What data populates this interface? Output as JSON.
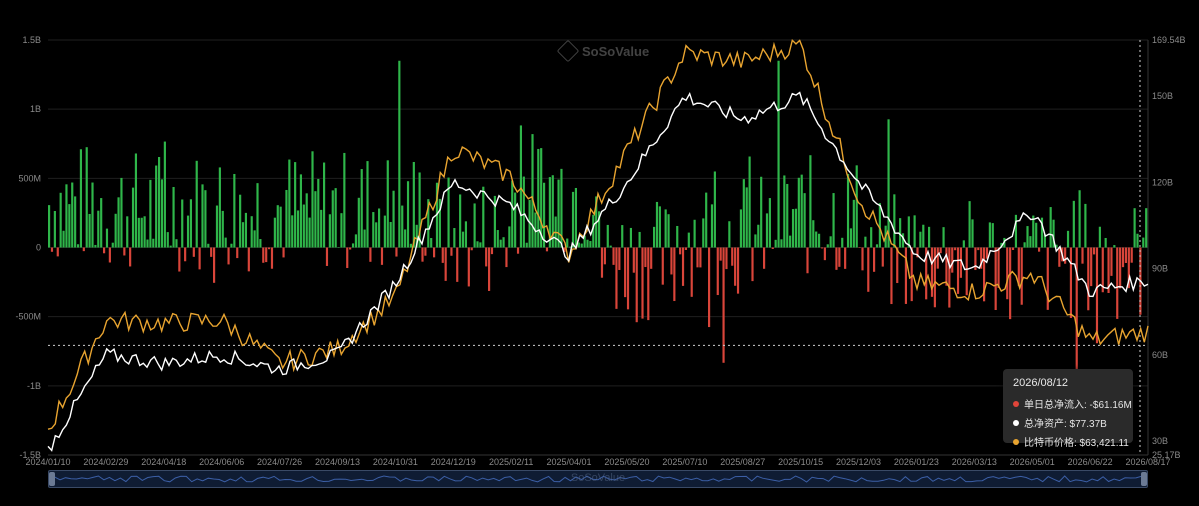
{
  "watermark": {
    "brand": "SoSoValue"
  },
  "chart_data": {
    "type": "bar",
    "left_axis_ticks": [
      "1.5B",
      "1B",
      "500M",
      "0",
      "-500M",
      "-1B",
      "-1.5B"
    ],
    "left_axis_values": [
      1.5,
      1,
      0.5,
      0,
      -0.5,
      -1,
      -1.5
    ],
    "right_axis_ticks": [
      "169.54B",
      "150B",
      "120B",
      "90B",
      "60B",
      "30B",
      "25.17B"
    ],
    "right_axis_values": [
      169.54,
      150,
      120,
      90,
      60,
      30,
      25.17
    ],
    "ylim_left": [
      -1.5,
      1.5
    ],
    "ylim_right": [
      25.17,
      169.54
    ],
    "x_ticks": [
      "2024/01/10",
      "2024/02/29",
      "2024/04/18",
      "2024/06/06",
      "2024/07/26",
      "2024/09/13",
      "2024/10/31",
      "2024/12/19",
      "2025/02/11",
      "2025/04/01",
      "2025/05/20",
      "2025/07/10",
      "2025/08/27",
      "2025/10/15",
      "2025/12/03",
      "2026/01/23",
      "2026/03/13",
      "2026/05/01",
      "2026/06/22",
      "2026/08/17"
    ],
    "crosshair_value_billion": 63.3,
    "series": [
      {
        "name": "单日总净流入",
        "color": "#d9453a",
        "color_positive": "#2fb64a",
        "role": "bars"
      },
      {
        "name": "总净资产",
        "color": "#ffffff",
        "role": "line",
        "x": [
          "2024/01/10",
          "2024/02/29",
          "2024/04/18",
          "2024/06/06",
          "2024/07/26",
          "2024/09/13",
          "2024/10/31",
          "2024/12/19",
          "2025/02/11",
          "2025/04/01",
          "2025/05/20",
          "2025/07/10",
          "2025/08/27",
          "2025/10/15",
          "2025/12/03",
          "2026/01/23",
          "2026/03/13",
          "2026/05/01",
          "2026/06/22",
          "2026/08/17"
        ],
        "values": [
          27,
          60,
          57,
          60,
          55,
          60,
          85,
          120,
          112,
          95,
          120,
          150,
          142,
          150,
          120,
          95,
          90,
          110,
          82,
          86
        ]
      },
      {
        "name": "比特币价格",
        "color": "#e8a430",
        "role": "line",
        "x": [
          "2024/01/10",
          "2024/02/29",
          "2024/04/18",
          "2024/06/06",
          "2024/07/26",
          "2024/09/13",
          "2024/10/31",
          "2024/12/19",
          "2025/02/11",
          "2025/04/01",
          "2025/05/20",
          "2025/07/10",
          "2025/08/27",
          "2025/10/15",
          "2025/12/03",
          "2026/01/23",
          "2026/03/13",
          "2026/05/01",
          "2026/06/22",
          "2026/08/17"
        ],
        "values": [
          34,
          72,
          71,
          72,
          57,
          62,
          80,
          132,
          122,
          95,
          131,
          165,
          162,
          168,
          115,
          85,
          82,
          88,
          65,
          68
        ]
      }
    ]
  },
  "tooltip": {
    "date": "2026/08/12",
    "rows": [
      {
        "label": "单日总净流入: -$61.16M",
        "color": "#e0453a"
      },
      {
        "label": "总净资产: $77.37B",
        "color": "#ffffff"
      },
      {
        "label": "比特币价格: $63,421.11",
        "color": "#e8a430"
      }
    ]
  }
}
